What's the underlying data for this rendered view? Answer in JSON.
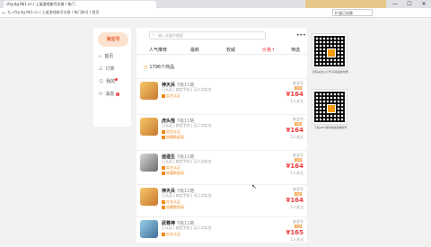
{
  "browser": {
    "tab_title": "cfzy.dg.9b1.cn / 上架游戏账号交易 / 热门",
    "address": "cfzy.dg.9b1.cn / 上架游戏账号交易 / 热门账号 / 首页",
    "extension_label": "扩展已加载",
    "minimize": "—",
    "maximize": "☐",
    "close": "✕"
  },
  "sidebar": {
    "logo_text": "淘宝号",
    "items": [
      {
        "icon": "⌂",
        "label": "首页"
      },
      {
        "icon": "☰",
        "label": "订单"
      },
      {
        "icon": "☺",
        "label": "我的"
      },
      {
        "icon": "✉",
        "label": "消息"
      }
    ],
    "message_badge": "1"
  },
  "main": {
    "search_placeholder": "输入关键字搜索",
    "more_icon": "•••",
    "tabs": [
      "人气推荐",
      "最新",
      "权威",
      "价格↑",
      "筛选"
    ],
    "count_text": "1796个商品",
    "rows": [
      {
        "name": "神天兵",
        "sub": "7级11格",
        "meta": "已认证 | 绑定手机 | 无二次实名",
        "tags": [
          "实名认证",
          ""
        ],
        "seller": "安全号",
        "badge": "包赔",
        "price": "¥164",
        "stock": "1人关注"
      },
      {
        "name": "虎头怪",
        "sub": "7级11格",
        "meta": "已认证 | 绑定手机 | 无二次实名",
        "tags": [
          "实名认证",
          "收藏数超高"
        ],
        "seller": "安全号",
        "badge": "包赔",
        "price": "¥164",
        "stock": "1人关注"
      },
      {
        "name": "逍遥生",
        "sub": "7级11格",
        "meta": "已认证 | 绑定手机 | 无二次实名",
        "tags": [
          "实名认证",
          "收藏数超高"
        ],
        "seller": "安全号",
        "badge": "包赔",
        "price": "¥164",
        "stock": "1人关注"
      },
      {
        "name": "神天兵",
        "sub": "7级11格",
        "meta": "已认证 | 绑定手机 | 无二次实名",
        "tags": [
          "实名认证",
          "收藏数超高"
        ],
        "seller": "安全号",
        "badge": "包赔",
        "price": "¥164",
        "stock": "1人关注"
      },
      {
        "name": "武尊神",
        "sub": "7级11格",
        "meta": "已认证 | 绑定手机 | 无二次实名",
        "tags": [
          "实名认证",
          ""
        ],
        "seller": "安全号",
        "badge": "包赔",
        "price": "¥165",
        "stock": "1人关注"
      }
    ]
  },
  "qr": [
    {
      "caption": "扫码关注公众号 获取最新优惠"
    },
    {
      "caption": "下载APP 随时随地查看账号"
    }
  ]
}
